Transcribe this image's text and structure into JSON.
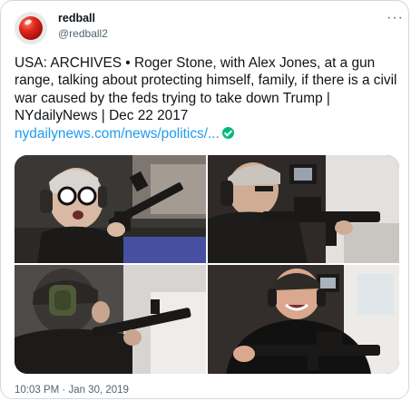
{
  "tweet": {
    "display_name": "redball",
    "handle": "@redball2",
    "more_icon": "···",
    "text": "USA: ARCHIVES • Roger Stone, with Alex Jones, at a gun range, talking about protecting himself, family, if there is a civil war caused by the feds trying to take down Trump | NYdailyNews | Dec 22 2017",
    "link_text": "nydailynews.com/news/politics/...",
    "timestamp": "10:03 PM · Jan 30, 2019"
  },
  "colors": {
    "link": "#1d9bf0",
    "secondary_text": "#536471",
    "verified": "#00ba7c",
    "avatar_ball": "#e2261c"
  },
  "icons": {
    "avatar": "red-ball-icon",
    "more": "more-horizontal-icon",
    "link_badge": "verified-check-icon"
  }
}
